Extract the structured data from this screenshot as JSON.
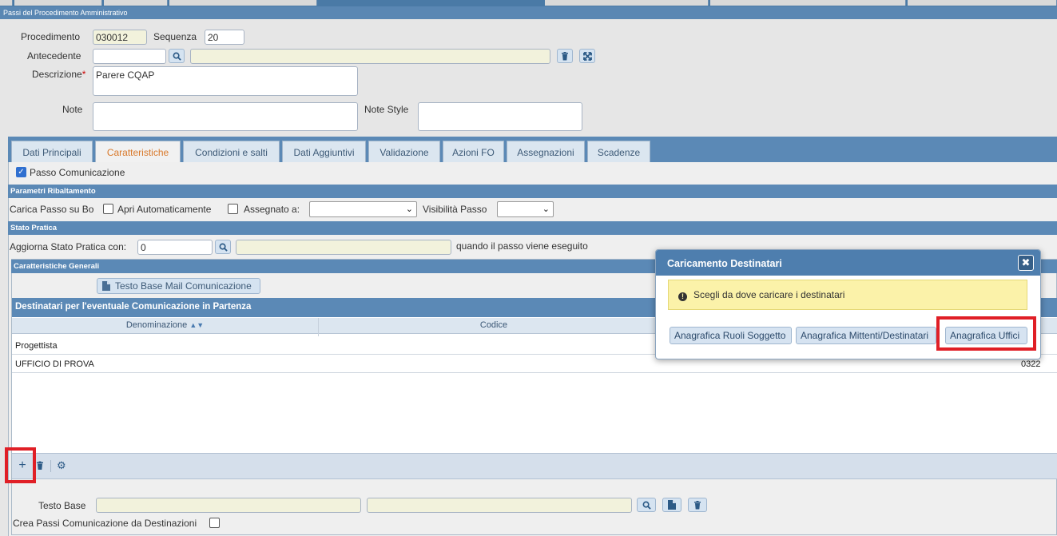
{
  "header": {
    "title": "Passi del Procedimento Amministrativo"
  },
  "form": {
    "procedimento_label": "Procedimento",
    "procedimento_value": "030012",
    "sequenza_label": "Sequenza",
    "sequenza_value": "20",
    "antecedente_label": "Antecedente",
    "descrizione_label": "Descrizione",
    "descrizione_required": "*",
    "descrizione_value": "Parere CQAP",
    "note_label": "Note",
    "note_style_label": "Note Style"
  },
  "tabs": [
    {
      "label": "Dati Principali"
    },
    {
      "label": "Caratteristiche"
    },
    {
      "label": "Condizioni e salti"
    },
    {
      "label": "Dati Aggiuntivi"
    },
    {
      "label": "Validazione"
    },
    {
      "label": "Azioni FO"
    },
    {
      "label": "Assegnazioni"
    },
    {
      "label": "Scadenze"
    }
  ],
  "panel": {
    "passo_comunicazione_label": "Passo Comunicazione",
    "parametri_title": "Parametri Ribaltamento",
    "carica_label": "Carica Passo su Bo",
    "apri_label": "Apri Automaticamente",
    "assegnato_label": "Assegnato a:",
    "visibilita_label": "Visibilità Passo",
    "stato_title": "Stato Pratica",
    "aggiorna_label": "Aggiorna Stato Pratica con:",
    "aggiorna_value": "0",
    "quando_label": "quando il passo viene eseguito",
    "caratteristiche_title": "Caratteristiche Generali",
    "testo_base_mail_button": "Testo Base Mail Comunicazione",
    "destinatari_title": "Destinatari per l'eventuale Comunicazione in Partenza",
    "columns": [
      "Denominazione",
      "Codice"
    ],
    "rows": [
      {
        "denominazione": "Progettista",
        "codice": "",
        "extra": ""
      },
      {
        "denominazione": "UFFICIO DI PROVA",
        "codice": "",
        "extra": "0322"
      }
    ],
    "testo_base_label": "Testo Base",
    "crea_passi_label": "Crea Passi Comunicazione da Destinazioni"
  },
  "modal": {
    "title": "Caricamento Destinatari",
    "close_glyph": "✖",
    "message": "Scegli da dove caricare i destinatari",
    "buttons": [
      {
        "label": "Anagrafica Ruoli Soggetto"
      },
      {
        "label": "Anagrafica Mittenti/Destinatari"
      },
      {
        "label": "Anagrafica Uffici"
      }
    ]
  },
  "colors": {
    "accent": "#5b89b6",
    "active_tab": "#d9792b",
    "highlight": "#e01f26"
  }
}
